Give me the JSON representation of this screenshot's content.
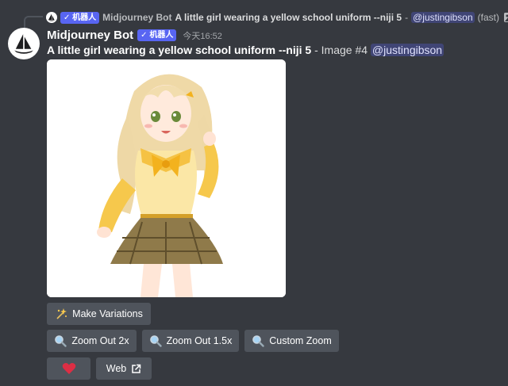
{
  "reply": {
    "bot_tag": "✓ 机器人",
    "name": "Midjourney Bot",
    "prompt": "A little girl wearing a yellow school uniform --niji 5",
    "separator": "-",
    "mention": "@justingibson",
    "mode": "(fast)"
  },
  "message": {
    "author": "Midjourney Bot",
    "bot_tag": "✓ 机器人",
    "timestamp": "今天16:52",
    "prompt": "A little girl wearing a yellow school uniform --niji 5",
    "separator": "-",
    "image_label": "Image #4",
    "mention": "@justingibson"
  },
  "buttons": {
    "make_variations": "Make Variations",
    "zoom_out_2x": "Zoom Out 2x",
    "zoom_out_1_5x": "Zoom Out 1.5x",
    "custom_zoom": "Custom Zoom",
    "web": "Web"
  },
  "icons": {
    "sparkles": "sparkles-icon",
    "magnifier": "magnifier-icon",
    "heart": "heart-icon",
    "external_link": "external-link-icon"
  },
  "colors": {
    "background": "#36393f",
    "button": "#4f545c",
    "bot_tag": "#5865f2",
    "mention_bg": "rgba(88,101,242,0.3)",
    "heart": "#dd2e44"
  }
}
